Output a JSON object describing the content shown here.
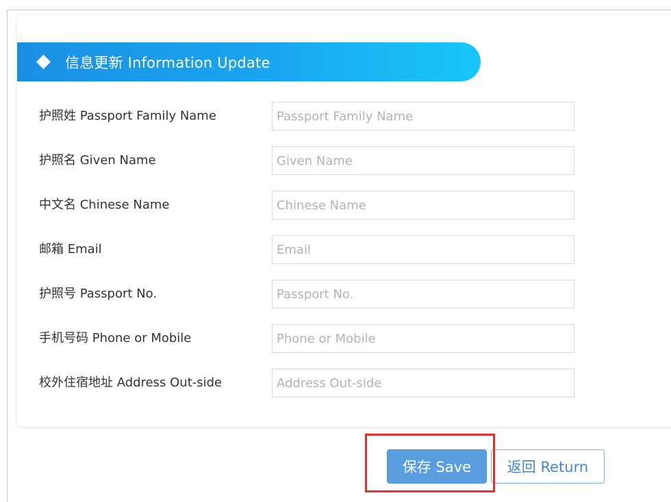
{
  "section": {
    "title": "信息更新 Information Update",
    "icon": "diamond-icon"
  },
  "form": {
    "fields": [
      {
        "label": "护照姓 Passport Family Name",
        "placeholder": "Passport Family Name",
        "value": ""
      },
      {
        "label": "护照名 Given Name",
        "placeholder": "Given Name",
        "value": ""
      },
      {
        "label": "中文名 Chinese Name",
        "placeholder": "Chinese Name",
        "value": ""
      },
      {
        "label": "邮箱 Email",
        "placeholder": "Email",
        "value": ""
      },
      {
        "label": "护照号 Passport No.",
        "placeholder": "Passport No.",
        "value": ""
      },
      {
        "label": "手机号码 Phone or Mobile",
        "placeholder": "Phone or Mobile",
        "value": ""
      },
      {
        "label": "校外住宿地址 Address Out-side",
        "placeholder": "Address Out-side",
        "value": ""
      }
    ]
  },
  "actions": {
    "save_label": "保存 Save",
    "return_label": "返回 Return"
  },
  "colors": {
    "header_gradient_start": "#1a8fe3",
    "header_gradient_end": "#19c6fa",
    "save_button_bg": "#5b9ee0",
    "return_button_text": "#3f86d6",
    "highlight_border": "#e0302a"
  }
}
